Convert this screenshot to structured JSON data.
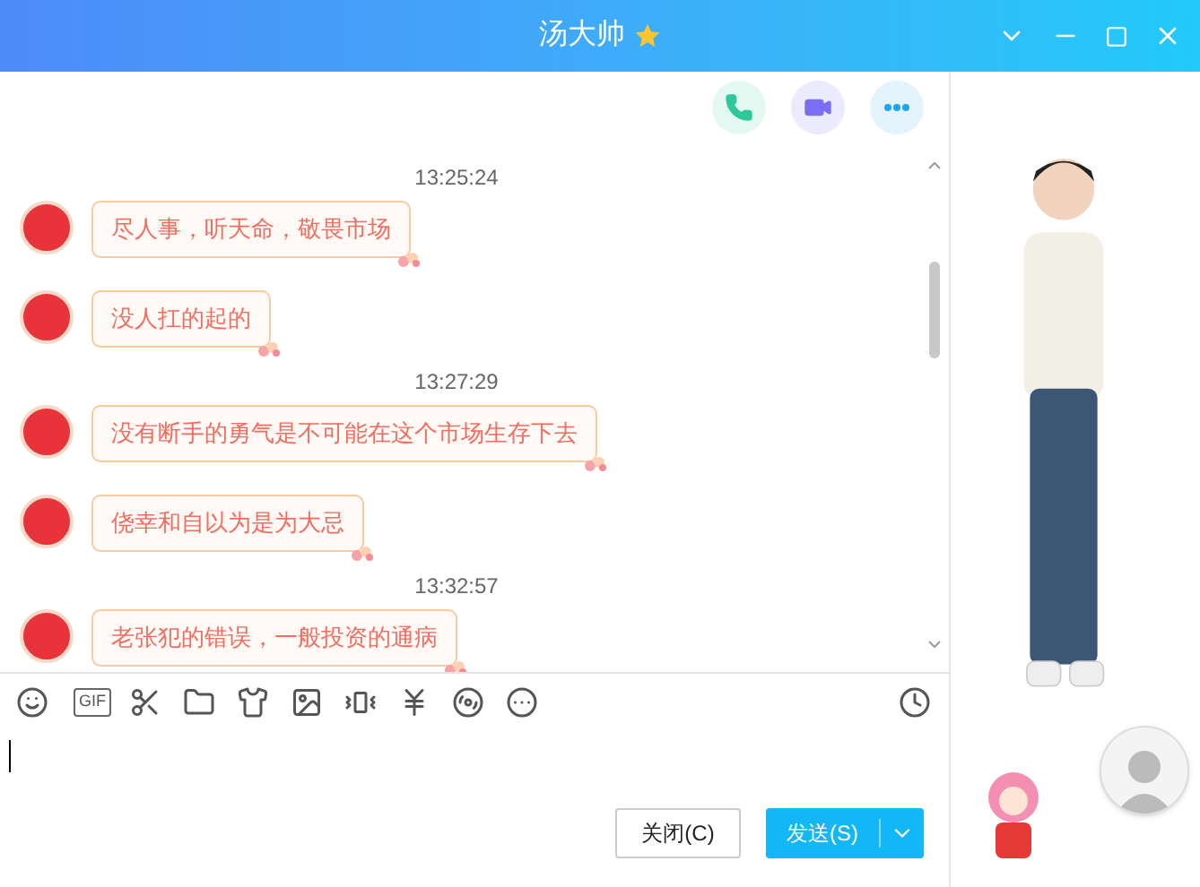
{
  "window": {
    "title": "汤大帅"
  },
  "messages": [
    {
      "kind": "time",
      "text": "13:25:24"
    },
    {
      "kind": "message",
      "text": "尽人事，听天命，敬畏市场"
    },
    {
      "kind": "message",
      "text": "没人扛的起的"
    },
    {
      "kind": "time",
      "text": "13:27:29"
    },
    {
      "kind": "message",
      "text": "没有断手的勇气是不可能在这个市场生存下去"
    },
    {
      "kind": "message",
      "text": "侥幸和自以为是为大忌"
    },
    {
      "kind": "time",
      "text": "13:32:57"
    },
    {
      "kind": "message",
      "text": "老张犯的错误，一般投资的通病"
    }
  ],
  "toolbar": {
    "gif_label": "GIF"
  },
  "buttons": {
    "close": "关闭(C)",
    "send": "发送(S)"
  }
}
